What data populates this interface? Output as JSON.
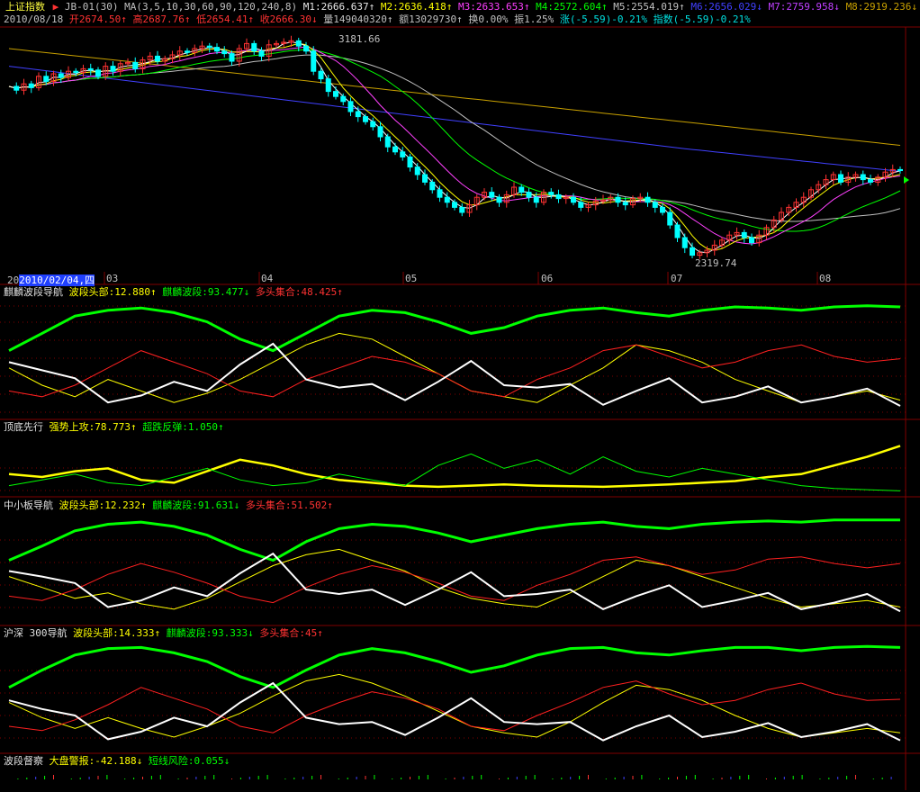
{
  "main_header": {
    "index_name": "上证指数",
    "formula": "JB-01(30)",
    "ma_params": "MA(3,5,10,30,60,90,120,240,8)",
    "m1": "M1:2666.637↑",
    "m2": "M2:2636.418↑",
    "m3": "M3:2633.653↑",
    "m4": "M4:2572.604↑",
    "m5": "M5:2554.019↑",
    "m6": "M6:2656.029↓",
    "m7": "M7:2759.958↓",
    "m8": "M8:2919.236↓"
  },
  "quote_bar": {
    "date": "2010/08/18",
    "open": "开2674.50↑",
    "high": "高2687.76↑",
    "low": "低2654.41↑",
    "close": "收2666.30↓",
    "volume": "量149040320↑",
    "amount": "额13029730↑",
    "turnover": "换0.00%",
    "amplitude": "振1.25%",
    "change": "涨(-5.59)-0.21%",
    "index_change": "指数(-5.59)-0.21%"
  },
  "time_axis": {
    "cursor_date": "2010/02/04,四",
    "months": [
      "03",
      "04",
      "05",
      "06",
      "07",
      "08"
    ]
  },
  "annotations": {
    "high": "3181.66",
    "low": "2319.74"
  },
  "panels": [
    {
      "title": "麒麟波段导航",
      "l1": "波段头部:12.880↑",
      "l2": "麒麟波段:93.477↓",
      "l3": "多头集合:48.425↑"
    },
    {
      "title": "顶底先行",
      "l1": "强势上攻:78.773↑",
      "l2": "超跌反弹:1.050↑"
    },
    {
      "title": "中小板导航",
      "l1": "波段头部:12.232↑",
      "l2": "麒麟波段:91.631↓",
      "l3": "多头集合:51.502↑"
    },
    {
      "title": "沪深 300导航",
      "l1": "波段头部:14.333↑",
      "l2": "麒麟波段:93.333↓",
      "l3": "多头集合:45↑"
    },
    {
      "title": "波段督察",
      "l1": "大盘警报:-42.188↓",
      "l2": "短线风险:0.055↓"
    }
  ],
  "colors": {
    "up": "#ff3232",
    "down": "#00ffff",
    "grid": "#800000",
    "ma3": "#ffffff",
    "ma5": "#ffff00",
    "ma10": "#ff40ff",
    "ma30": "#00ff00",
    "ma60": "#c0c0c0",
    "ma120": "#4040ff",
    "ma240": "#c8a000",
    "ma90": "#c040ff"
  },
  "chart_data": [
    {
      "type": "candlestick",
      "title": "上证指数",
      "x": [
        "2010-02",
        "2010-03",
        "2010-04",
        "2010-05",
        "2010-06",
        "2010-07",
        "2010-08"
      ],
      "close_path": [
        3000,
        2985,
        3010,
        2995,
        3040,
        3020,
        3050,
        3035,
        3060,
        3055,
        3070,
        3065,
        3040,
        3080,
        3060,
        3090,
        3095,
        3070,
        3105,
        3120,
        3100,
        3110,
        3125,
        3140,
        3135,
        3150,
        3160,
        3155,
        3140,
        3130,
        3100,
        3150,
        3170,
        3140,
        3120,
        3165,
        3170,
        3175,
        3181,
        3160,
        3140,
        3060,
        3030,
        2980,
        2960,
        2940,
        2900,
        2880,
        2860,
        2840,
        2800,
        2760,
        2740,
        2720,
        2680,
        2650,
        2620,
        2590,
        2560,
        2540,
        2520,
        2500,
        2530,
        2560,
        2580,
        2560,
        2540,
        2570,
        2600,
        2580,
        2560,
        2540,
        2580,
        2570,
        2555,
        2560,
        2540,
        2520,
        2530,
        2545,
        2550,
        2560,
        2540,
        2530,
        2555,
        2560,
        2540,
        2520,
        2500,
        2450,
        2400,
        2360,
        2330,
        2340,
        2350,
        2370,
        2390,
        2410,
        2420,
        2400,
        2380,
        2410,
        2440,
        2470,
        2500,
        2520,
        2540,
        2560,
        2590,
        2610,
        2630,
        2650,
        2620,
        2640,
        2650,
        2630,
        2620,
        2640,
        2660,
        2670,
        2666
      ],
      "annotations": [
        {
          "text": "3181.66"
        },
        {
          "text": "2319.74"
        }
      ]
    },
    {
      "type": "line",
      "title": "麒麟波段导航",
      "ylim": [
        0,
        100
      ],
      "series": [
        {
          "name": "波段头部",
          "values": [
            40,
            25,
            15,
            30,
            20,
            10,
            18,
            30,
            45,
            60,
            70,
            65,
            50,
            35,
            20,
            15,
            10,
            25,
            40,
            60,
            55,
            45,
            30,
            20,
            10,
            15,
            20,
            12
          ]
        },
        {
          "name": "麒麟波段",
          "values": [
            55,
            70,
            85,
            90,
            92,
            88,
            80,
            65,
            55,
            70,
            85,
            90,
            88,
            80,
            70,
            75,
            85,
            90,
            92,
            88,
            85,
            90,
            93,
            92,
            90,
            93,
            94,
            93
          ]
        },
        {
          "name": "多头集合",
          "values": [
            20,
            15,
            25,
            40,
            55,
            45,
            35,
            20,
            15,
            30,
            40,
            50,
            45,
            35,
            20,
            15,
            30,
            40,
            55,
            60,
            50,
            40,
            45,
            55,
            60,
            50,
            45,
            48
          ]
        }
      ]
    },
    {
      "type": "line",
      "title": "顶底先行",
      "ylim": [
        0,
        100
      ],
      "series": [
        {
          "name": "强势上攻",
          "values": [
            30,
            25,
            35,
            40,
            20,
            15,
            35,
            55,
            45,
            30,
            20,
            15,
            10,
            8,
            10,
            12,
            10,
            9,
            8,
            10,
            12,
            15,
            18,
            25,
            30,
            45,
            60,
            79
          ]
        },
        {
          "name": "超跌反弹",
          "values": [
            10,
            20,
            30,
            15,
            10,
            25,
            40,
            20,
            10,
            15,
            30,
            20,
            10,
            45,
            65,
            40,
            55,
            30,
            60,
            35,
            25,
            40,
            30,
            20,
            10,
            5,
            3,
            1
          ]
        }
      ]
    },
    {
      "type": "line",
      "title": "中小板导航",
      "ylim": [
        0,
        100
      ],
      "series": [
        {
          "name": "波段头部",
          "values": [
            40,
            30,
            20,
            25,
            15,
            10,
            20,
            35,
            50,
            60,
            65,
            55,
            45,
            30,
            20,
            15,
            12,
            25,
            40,
            55,
            50,
            40,
            30,
            20,
            12,
            15,
            18,
            12
          ]
        },
        {
          "name": "麒麟波段",
          "values": [
            55,
            68,
            82,
            88,
            90,
            86,
            78,
            65,
            55,
            72,
            84,
            88,
            86,
            80,
            72,
            78,
            84,
            88,
            90,
            86,
            84,
            88,
            90,
            91,
            90,
            92,
            92,
            92
          ]
        },
        {
          "name": "多头集合",
          "values": [
            22,
            18,
            28,
            42,
            52,
            44,
            34,
            22,
            16,
            30,
            42,
            50,
            44,
            34,
            22,
            18,
            32,
            42,
            55,
            58,
            50,
            42,
            46,
            56,
            58,
            52,
            48,
            52
          ]
        }
      ]
    },
    {
      "type": "line",
      "title": "沪深 300导航",
      "ylim": [
        0,
        100
      ],
      "series": [
        {
          "name": "波段头部",
          "values": [
            42,
            28,
            18,
            28,
            18,
            10,
            20,
            32,
            48,
            62,
            68,
            60,
            48,
            34,
            20,
            14,
            10,
            24,
            42,
            58,
            54,
            44,
            30,
            18,
            10,
            14,
            18,
            14
          ]
        },
        {
          "name": "麒麟波段",
          "values": [
            56,
            72,
            86,
            92,
            93,
            88,
            80,
            66,
            56,
            72,
            86,
            92,
            88,
            80,
            70,
            76,
            86,
            92,
            93,
            88,
            86,
            90,
            93,
            93,
            90,
            93,
            94,
            93
          ]
        },
        {
          "name": "多头集合",
          "values": [
            20,
            16,
            26,
            40,
            56,
            46,
            36,
            20,
            14,
            30,
            42,
            52,
            46,
            36,
            20,
            16,
            30,
            42,
            56,
            62,
            50,
            40,
            44,
            54,
            60,
            50,
            44,
            45
          ]
        }
      ]
    },
    {
      "type": "line",
      "title": "波段督察",
      "series": [
        {
          "name": "大盘警报",
          "values": [
            -10,
            -20,
            -30,
            -25,
            -35,
            -40,
            -30,
            -25,
            -38,
            -42
          ]
        },
        {
          "name": "短线风险",
          "values": [
            0.2,
            0.1,
            0.15,
            0.08,
            0.12,
            0.05,
            0.1,
            0.06,
            0.07,
            0.055
          ]
        }
      ]
    }
  ]
}
